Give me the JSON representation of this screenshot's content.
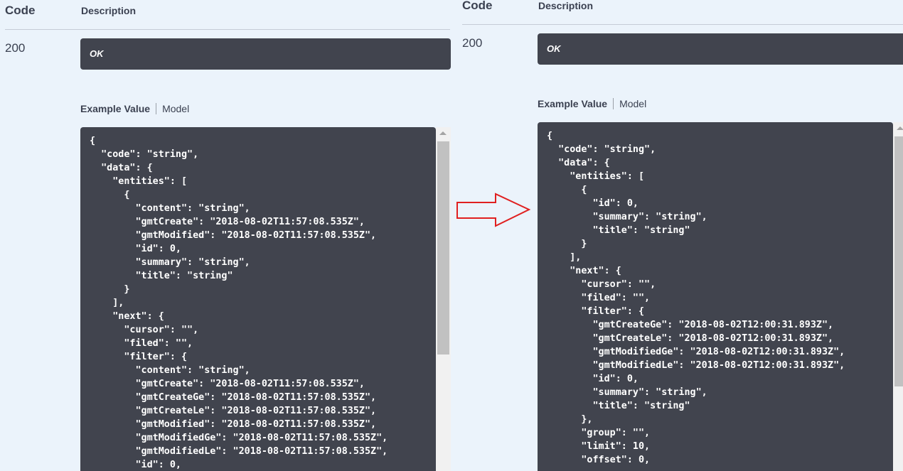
{
  "left": {
    "col_code": "Code",
    "col_description": "Description",
    "status_code": "200",
    "description": "OK",
    "tab_example": "Example Value",
    "tab_model": "Model",
    "code": "{\n  \"code\": \"string\",\n  \"data\": {\n    \"entities\": [\n      {\n        \"content\": \"string\",\n        \"gmtCreate\": \"2018-08-02T11:57:08.535Z\",\n        \"gmtModified\": \"2018-08-02T11:57:08.535Z\",\n        \"id\": 0,\n        \"summary\": \"string\",\n        \"title\": \"string\"\n      }\n    ],\n    \"next\": {\n      \"cursor\": \"\",\n      \"filed\": \"\",\n      \"filter\": {\n        \"content\": \"string\",\n        \"gmtCreate\": \"2018-08-02T11:57:08.535Z\",\n        \"gmtCreateGe\": \"2018-08-02T11:57:08.535Z\",\n        \"gmtCreateLe\": \"2018-08-02T11:57:08.535Z\",\n        \"gmtModified\": \"2018-08-02T11:57:08.535Z\",\n        \"gmtModifiedGe\": \"2018-08-02T11:57:08.535Z\",\n        \"gmtModifiedLe\": \"2018-08-02T11:57:08.535Z\",\n        \"id\": 0,"
  },
  "right": {
    "col_code": "Code",
    "col_description": "Description",
    "status_code": "200",
    "description": "OK",
    "tab_example": "Example Value",
    "tab_model": "Model",
    "code": "{\n  \"code\": \"string\",\n  \"data\": {\n    \"entities\": [\n      {\n        \"id\": 0,\n        \"summary\": \"string\",\n        \"title\": \"string\"\n      }\n    ],\n    \"next\": {\n      \"cursor\": \"\",\n      \"filed\": \"\",\n      \"filter\": {\n        \"gmtCreateGe\": \"2018-08-02T12:00:31.893Z\",\n        \"gmtCreateLe\": \"2018-08-02T12:00:31.893Z\",\n        \"gmtModifiedGe\": \"2018-08-02T12:00:31.893Z\",\n        \"gmtModifiedLe\": \"2018-08-02T12:00:31.893Z\",\n        \"id\": 0,\n        \"summary\": \"string\",\n        \"title\": \"string\"\n      },\n      \"group\": \"\",\n      \"limit\": 10,\n      \"offset\": 0,"
  },
  "arrow": {
    "icon": "right-arrow-outline-icon",
    "color": "#e02020"
  },
  "colors": {
    "background": "#ebf3fb",
    "code_bg": "#41444e",
    "text": "#3b4151"
  }
}
